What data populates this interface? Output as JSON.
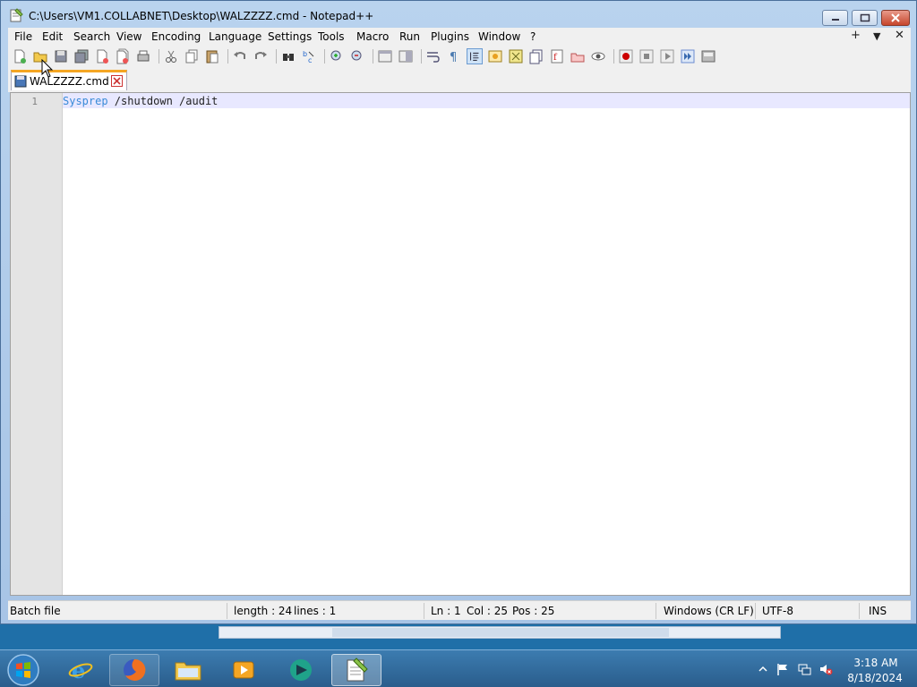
{
  "window": {
    "title": "C:\\Users\\VM1.COLLABNET\\Desktop\\WALZZZZ.cmd - Notepad++"
  },
  "menu": [
    "File",
    "Edit",
    "Search",
    "View",
    "Encoding",
    "Language",
    "Settings",
    "Tools",
    "Macro",
    "Run",
    "Plugins",
    "Window",
    "?"
  ],
  "menu_right": {
    "add": "+",
    "dropdown": "▼",
    "close": "✕"
  },
  "tab": {
    "label": "WALZZZZ.cmd"
  },
  "editor": {
    "line_number": "1",
    "keyword": "Sysprep",
    "args": " /shutdown /audit"
  },
  "status": {
    "file_type": "Batch file",
    "length": "length : 24",
    "lines": "lines : 1",
    "ln": "Ln : 1",
    "col": "Col : 25",
    "pos": "Pos : 25",
    "eol": "Windows (CR LF)",
    "encoding": "UTF-8",
    "mode": "INS"
  },
  "taskbar": {
    "apps": [
      "start",
      "internet-explorer",
      "firefox",
      "file-explorer",
      "media-player",
      "app-teal",
      "notepad-plus-plus"
    ],
    "clock_time": "3:18 AM",
    "clock_date": "8/18/2024"
  },
  "colors": {
    "keyword": "#3a8bd8",
    "tab_accent": "#f5a623",
    "current_line": "#e8e8ff"
  }
}
